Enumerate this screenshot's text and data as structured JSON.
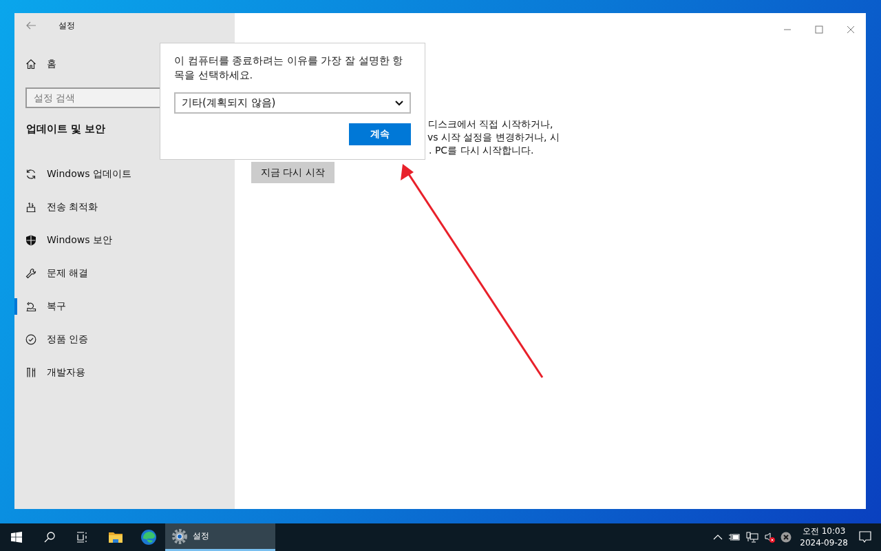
{
  "window": {
    "title": "설정"
  },
  "sidebar": {
    "home": "홈",
    "search": {
      "placeholder": "설정 검색"
    },
    "section_title": "업데이트 및 보안",
    "items": [
      {
        "label": "Windows 업데이트",
        "selected": false
      },
      {
        "label": "전송 최적화",
        "selected": false
      },
      {
        "label": "Windows 보안",
        "selected": false
      },
      {
        "label": "문제 해결",
        "selected": false
      },
      {
        "label": "복구",
        "selected": true
      },
      {
        "label": "정품 인증",
        "selected": false
      },
      {
        "label": "개발자용",
        "selected": false
      }
    ]
  },
  "content": {
    "text_lines": [
      "디스크에서 직접 시작하거나,",
      "vs 시작 설정을 변경하거나, 시",
      ". PC를 다시 시작합니다."
    ],
    "restart_button": "지금 다시 시작"
  },
  "dialog": {
    "prompt": "이 컴퓨터를 종료하려는 이유를 가장 잘 설명한 항목을 선택하세요.",
    "dropdown": {
      "value": "기타(계획되지 않음)"
    },
    "continue_button": "계속"
  },
  "taskbar": {
    "active_app": {
      "label": "설정",
      "selected": true
    },
    "time": "오전 10:03",
    "date": "2024-09-28"
  }
}
